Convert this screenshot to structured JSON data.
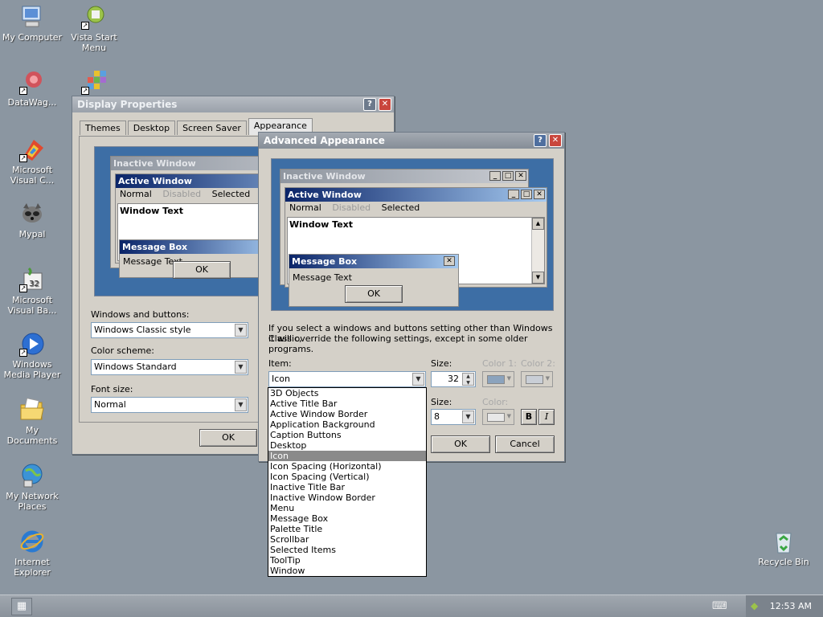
{
  "desktop": {
    "icons": [
      {
        "label": "My Computer"
      },
      {
        "label": "Vista Start Menu"
      },
      {
        "label": "DataWag..."
      },
      {
        "label": "Microsoft Visual C..."
      },
      {
        "label": "Mypal"
      },
      {
        "label": "Microsoft Visual Ba..."
      },
      {
        "label": "Windows Media Player"
      },
      {
        "label": "My Documents"
      },
      {
        "label": "My Network Places"
      },
      {
        "label": "Internet Explorer"
      },
      {
        "label": "Recycle Bin"
      }
    ]
  },
  "display_properties": {
    "title": "Display Properties",
    "tabs": [
      "Themes",
      "Desktop",
      "Screen Saver",
      "Appearance"
    ],
    "preview": {
      "inactive_window": "Inactive Window",
      "active_window": "Active Window",
      "menu_normal": "Normal",
      "menu_disabled": "Disabled",
      "menu_selected": "Selected",
      "window_text": "Window Text",
      "message_box": "Message Box",
      "message_text": "Message Text",
      "ok": "OK"
    },
    "windows_buttons_label": "Windows and buttons:",
    "windows_buttons_value": "Windows Classic style",
    "color_scheme_label": "Color scheme:",
    "color_scheme_value": "Windows Standard",
    "font_size_label": "Font size:",
    "font_size_value": "Normal",
    "ok": "OK"
  },
  "advanced": {
    "title": "Advanced Appearance",
    "preview": {
      "inactive_window": "Inactive Window",
      "active_window": "Active Window",
      "menu_normal": "Normal",
      "menu_disabled": "Disabled",
      "menu_selected": "Selected",
      "window_text": "Window Text",
      "message_box": "Message Box",
      "message_text": "Message Text",
      "ok": "OK"
    },
    "info_line1": "If you select a windows and buttons setting other than Windows Classic,",
    "info_line2": "it will override the following settings, except in some older programs.",
    "item_label": "Item:",
    "item_value": "Icon",
    "size_label": "Size:",
    "size_value": "32",
    "color1_label": "Color 1:",
    "color2_label": "Color 2:",
    "font_size_label": "Size:",
    "font_size_value": "8",
    "font_color_label": "Color:",
    "bold": "B",
    "italic": "I",
    "ok": "OK",
    "cancel": "Cancel",
    "item_options": [
      "3D Objects",
      "Active Title Bar",
      "Active Window Border",
      "Application Background",
      "Caption Buttons",
      "Desktop",
      "Icon",
      "Icon Spacing (Horizontal)",
      "Icon Spacing (Vertical)",
      "Inactive Title Bar",
      "Inactive Window Border",
      "Menu",
      "Message Box",
      "Palette Title",
      "Scrollbar",
      "Selected Items",
      "ToolTip",
      "Window"
    ],
    "selected_option": "Icon"
  },
  "taskbar": {
    "clock": "12:53 AM"
  },
  "colors": {
    "desktop": "#8b96a1",
    "preview_bg": "#3d6ea5",
    "active_title": "#0a2468",
    "list_selected": "#8a8a8a"
  }
}
